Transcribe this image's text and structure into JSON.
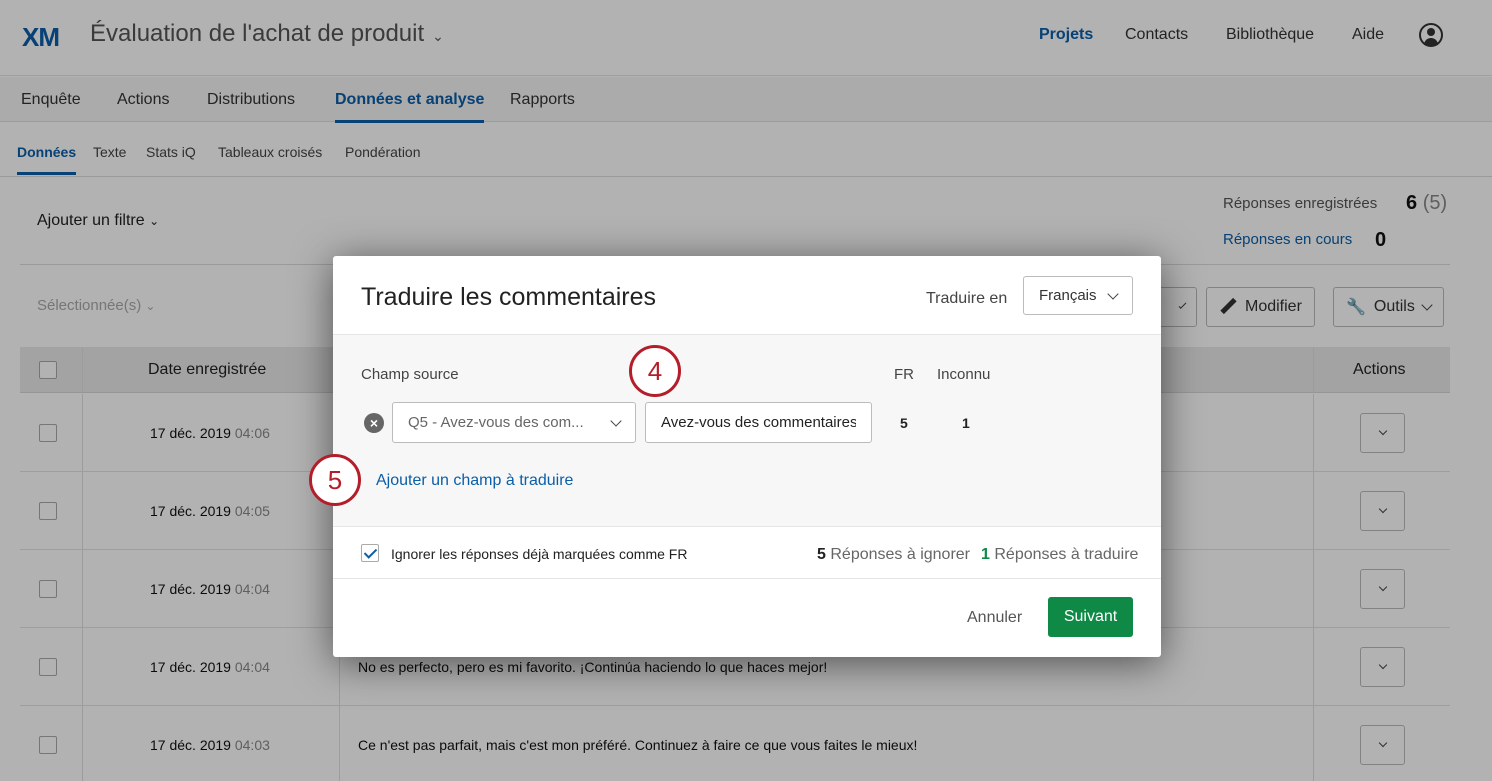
{
  "header": {
    "logo": "XM",
    "project_title": "Évaluation de l'achat de produit",
    "nav": [
      "Projets",
      "Contacts",
      "Bibliothèque",
      "Aide"
    ]
  },
  "section_tabs": [
    "Enquête",
    "Actions",
    "Distributions",
    "Données et analyse",
    "Rapports"
  ],
  "sub_tabs": [
    "Données",
    "Texte",
    "Stats iQ",
    "Tableaux croisés",
    "Pondération"
  ],
  "filter_label": "Ajouter un filtre",
  "stats": {
    "recorded_label": "Réponses enregistrées",
    "recorded_value": "6",
    "recorded_sub": "(5)",
    "in_progress_label": "Réponses en cours",
    "in_progress_value": "0"
  },
  "toolbar": {
    "selected_label": "Sélectionnée(s)",
    "edit_label": "Modifier",
    "tools_label": "Outils"
  },
  "table": {
    "date_header": "Date enregistrée",
    "actions_header": "Actions",
    "rows": [
      {
        "date": "17 déc. 2019",
        "time": "04:06",
        "text": ""
      },
      {
        "date": "17 déc. 2019",
        "time": "04:05",
        "text": ""
      },
      {
        "date": "17 déc. 2019",
        "time": "04:04",
        "text": ""
      },
      {
        "date": "17 déc. 2019",
        "time": "04:04",
        "text": "No es perfecto, pero es mi favorito. ¡Continúa haciendo lo que haces mejor!"
      },
      {
        "date": "17 déc. 2019",
        "time": "04:03",
        "text": "Ce n'est pas parfait, mais c'est mon préféré. Continuez à faire ce que vous faites le mieux!"
      }
    ]
  },
  "modal": {
    "title": "Traduire les commentaires",
    "translate_to_label": "Traduire en",
    "language": "Français",
    "source_field_label": "Champ source",
    "col_fr": "FR",
    "col_unknown": "Inconnu",
    "source_select": "Q5 - Avez-vous des com...",
    "field_input_value": "Avez-vous des commentaires",
    "count_fr": "5",
    "count_unknown": "1",
    "add_field_link": "Ajouter un champ à traduire",
    "ignore_label": "Ignorer les réponses déjà marquées comme FR",
    "ignore_count": "5",
    "ignore_text": "Réponses à ignorer",
    "translate_count": "1",
    "translate_text": "Réponses à traduire",
    "cancel_label": "Annuler",
    "next_label": "Suivant"
  },
  "callouts": [
    "4",
    "5"
  ],
  "colors": {
    "brand_blue": "#0b5ea8",
    "next_green": "#0e8a46",
    "callout_red": "#b41e2a"
  }
}
